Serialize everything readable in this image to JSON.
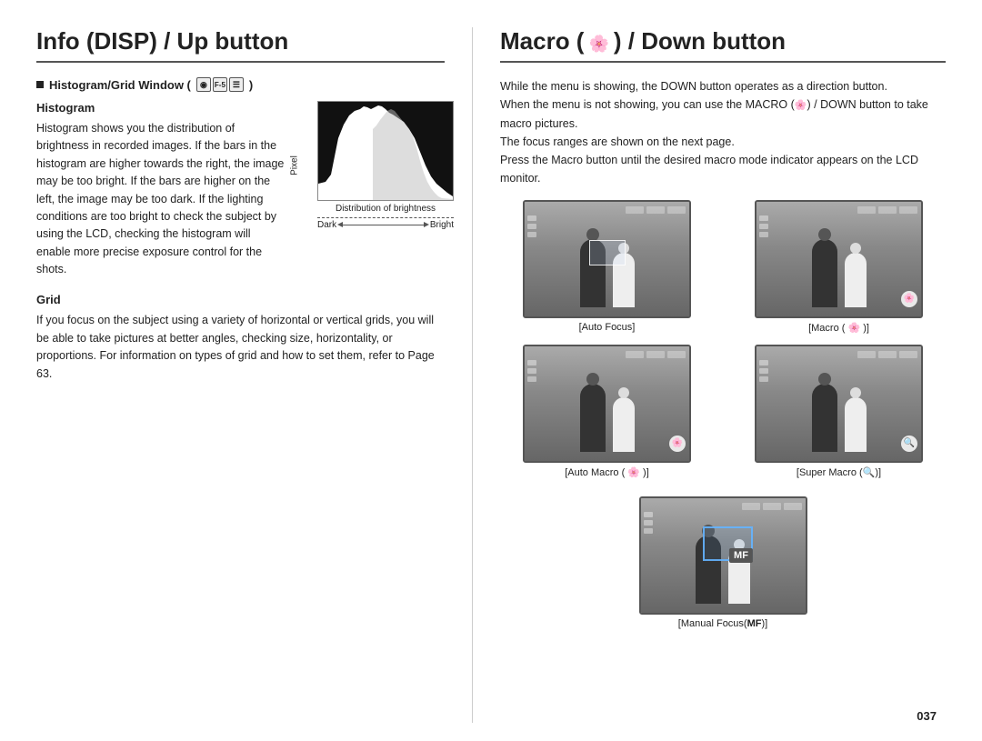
{
  "left": {
    "title": "Info (DISP) / Up button",
    "subsection_label": "Histogram/Grid Window (",
    "histogram_heading": "Histogram",
    "histogram_body": "Histogram shows you the distribution of brightness in recorded images. If the bars in the histogram are higher towards the right, the image may be too bright. If the bars are higher on the left, the image may be too dark. If the lighting conditions are too bright to check the subject by using the LCD, checking the histogram will enable more precise exposure control for the shots.",
    "distribution_label": "Distribution of brightness",
    "dark_label": "Dark",
    "bright_label": "Bright",
    "pixel_label": "Pixel",
    "grid_heading": "Grid",
    "grid_body": "If you focus on the subject using a variety of horizontal or vertical grids, you will be able to take pictures at better angles, checking size, horizontality, or proportions. For information on types of grid and how to set them, refer to Page 63."
  },
  "right": {
    "title": "Macro (  ) / Down button",
    "para1": "While the menu is showing, the DOWN button operates as a direction button.",
    "para2": "When the menu is not showing, you can use the MACRO (  ) / DOWN button to take macro pictures.",
    "para3": "The focus ranges are shown on the next page.",
    "para4": "Press the Macro button until the desired macro mode indicator appears on the LCD monitor.",
    "images": [
      {
        "id": "auto-focus",
        "caption": "[Auto Focus]",
        "badge": "",
        "has_focus_box": true,
        "bg_class": "cs-bg-1"
      },
      {
        "id": "macro",
        "caption": "[Macro (  )]",
        "badge": "🌸",
        "has_focus_box": false,
        "bg_class": "cs-bg-2"
      },
      {
        "id": "auto-macro",
        "caption": "[Auto Macro (  )]",
        "badge": "🌸",
        "has_focus_box": false,
        "bg_class": "cs-bg-3"
      },
      {
        "id": "super-macro",
        "caption": "[Super Macro (🔍)]",
        "badge": "🔍",
        "has_focus_box": false,
        "bg_class": "cs-bg-4"
      }
    ],
    "manual_focus_caption": "[Manual Focus(MF)]"
  },
  "page_number": "037"
}
